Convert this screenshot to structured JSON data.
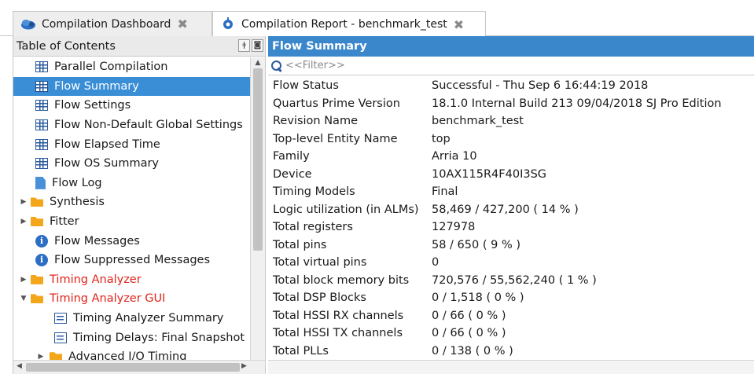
{
  "tabs": [
    {
      "label": "Compilation Dashboard",
      "active": false
    },
    {
      "label": "Compilation Report - benchmark_test",
      "active": true
    }
  ],
  "toc": {
    "title": "Table of Contents",
    "items": [
      {
        "label": "Parallel Compilation",
        "icon": "table-icon",
        "level": 0
      },
      {
        "label": "Flow Summary",
        "icon": "table-icon",
        "level": 0,
        "selected": true
      },
      {
        "label": "Flow Settings",
        "icon": "table-icon",
        "level": 0
      },
      {
        "label": "Flow Non-Default Global Settings",
        "icon": "table-icon",
        "level": 0
      },
      {
        "label": "Flow Elapsed Time",
        "icon": "table-icon",
        "level": 0
      },
      {
        "label": "Flow OS Summary",
        "icon": "table-icon",
        "level": 0
      },
      {
        "label": "Flow Log",
        "icon": "document-icon",
        "level": 0
      },
      {
        "label": "Synthesis",
        "icon": "folder-icon",
        "level": 0,
        "expandable": true
      },
      {
        "label": "Fitter",
        "icon": "folder-icon",
        "level": 0,
        "expandable": true
      },
      {
        "label": "Flow Messages",
        "icon": "info-icon",
        "level": 0
      },
      {
        "label": "Flow Suppressed Messages",
        "icon": "info-icon",
        "level": 0
      },
      {
        "label": "Timing Analyzer",
        "icon": "folder-icon",
        "level": 0,
        "expandable": true,
        "red": true
      },
      {
        "label": "Timing Analyzer GUI",
        "icon": "folder-icon",
        "level": 0,
        "expanded": true,
        "red": true
      },
      {
        "label": "Timing Analyzer Summary",
        "icon": "report-icon",
        "level": 1
      },
      {
        "label": "Timing Delays: Final Snapshot",
        "icon": "report-icon",
        "level": 1
      },
      {
        "label": "Advanced I/O Timing",
        "icon": "folder-icon",
        "level": 1,
        "expandable": true
      }
    ]
  },
  "panel": {
    "title": "Flow Summary",
    "filter_placeholder": "<<Filter>>"
  },
  "summary": [
    {
      "key": "Flow Status",
      "value": "Successful - Thu Sep  6 16:44:19 2018"
    },
    {
      "key": "Quartus Prime Version",
      "value": "18.1.0 Internal Build 213 09/04/2018 SJ Pro Edition"
    },
    {
      "key": "Revision Name",
      "value": "benchmark_test"
    },
    {
      "key": "Top-level Entity Name",
      "value": "top"
    },
    {
      "key": "Family",
      "value": "Arria 10"
    },
    {
      "key": "Device",
      "value": "10AX115R4F40I3SG"
    },
    {
      "key": "Timing Models",
      "value": "Final"
    },
    {
      "key": "Logic utilization (in ALMs)",
      "value": "58,469 / 427,200 ( 14 % )"
    },
    {
      "key": "Total registers",
      "value": "127978"
    },
    {
      "key": "Total pins",
      "value": "58 / 650 ( 9 % )"
    },
    {
      "key": "Total virtual pins",
      "value": "0"
    },
    {
      "key": "Total block memory bits",
      "value": "720,576 / 55,562,240 ( 1 % )"
    },
    {
      "key": "Total DSP Blocks",
      "value": "0 / 1,518 ( 0 % )"
    },
    {
      "key": "Total HSSI RX channels",
      "value": "0 / 66 ( 0 % )"
    },
    {
      "key": "Total HSSI TX channels",
      "value": "0 / 66 ( 0 % )"
    },
    {
      "key": "Total PLLs",
      "value": "0 / 138 ( 0 % )"
    }
  ]
}
